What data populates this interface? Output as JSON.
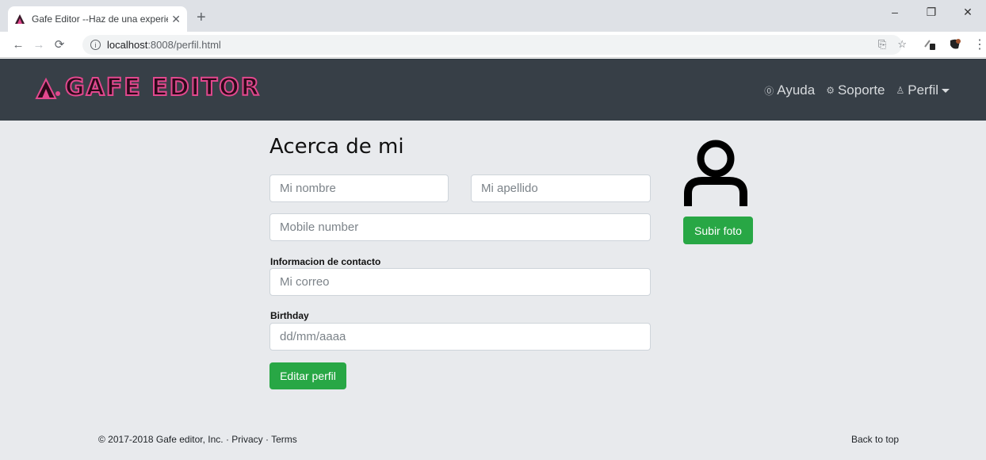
{
  "browser": {
    "tab_title": "Gafe Editor --Haz de una experie",
    "tab_close": "✕",
    "new_tab": "+",
    "url_host": "localhost",
    "url_path": ":8008/perfil.html",
    "window_controls": [
      "–",
      "❐",
      "✕"
    ]
  },
  "site": {
    "brand": "GAFE EDITOR",
    "nav": {
      "help": "Ayuda",
      "support": "Soporte",
      "profile": "Perfil"
    }
  },
  "profile": {
    "heading": "Acerca de mi",
    "first_name_placeholder": "Mi nombre",
    "last_name_placeholder": "Mi apellido",
    "mobile_placeholder": "Mobile number",
    "contact_label": "Informacion de contacto",
    "email_placeholder": "Mi correo",
    "birthday_label": "Birthday",
    "birthday_placeholder": "dd/mm/aaaa",
    "edit_button": "Editar perfil",
    "upload_button": "Subir foto"
  },
  "footer": {
    "copyright": "© 2017-2018 Gafe editor, Inc. · ",
    "privacy": "Privacy",
    "separator": " · ",
    "terms": "Terms",
    "back_to_top": "Back to top"
  },
  "colors": {
    "navbar": "#373f47",
    "page_bg": "#e8eaed",
    "accent_green": "#28a745",
    "brand_pink": "#e2488e"
  }
}
